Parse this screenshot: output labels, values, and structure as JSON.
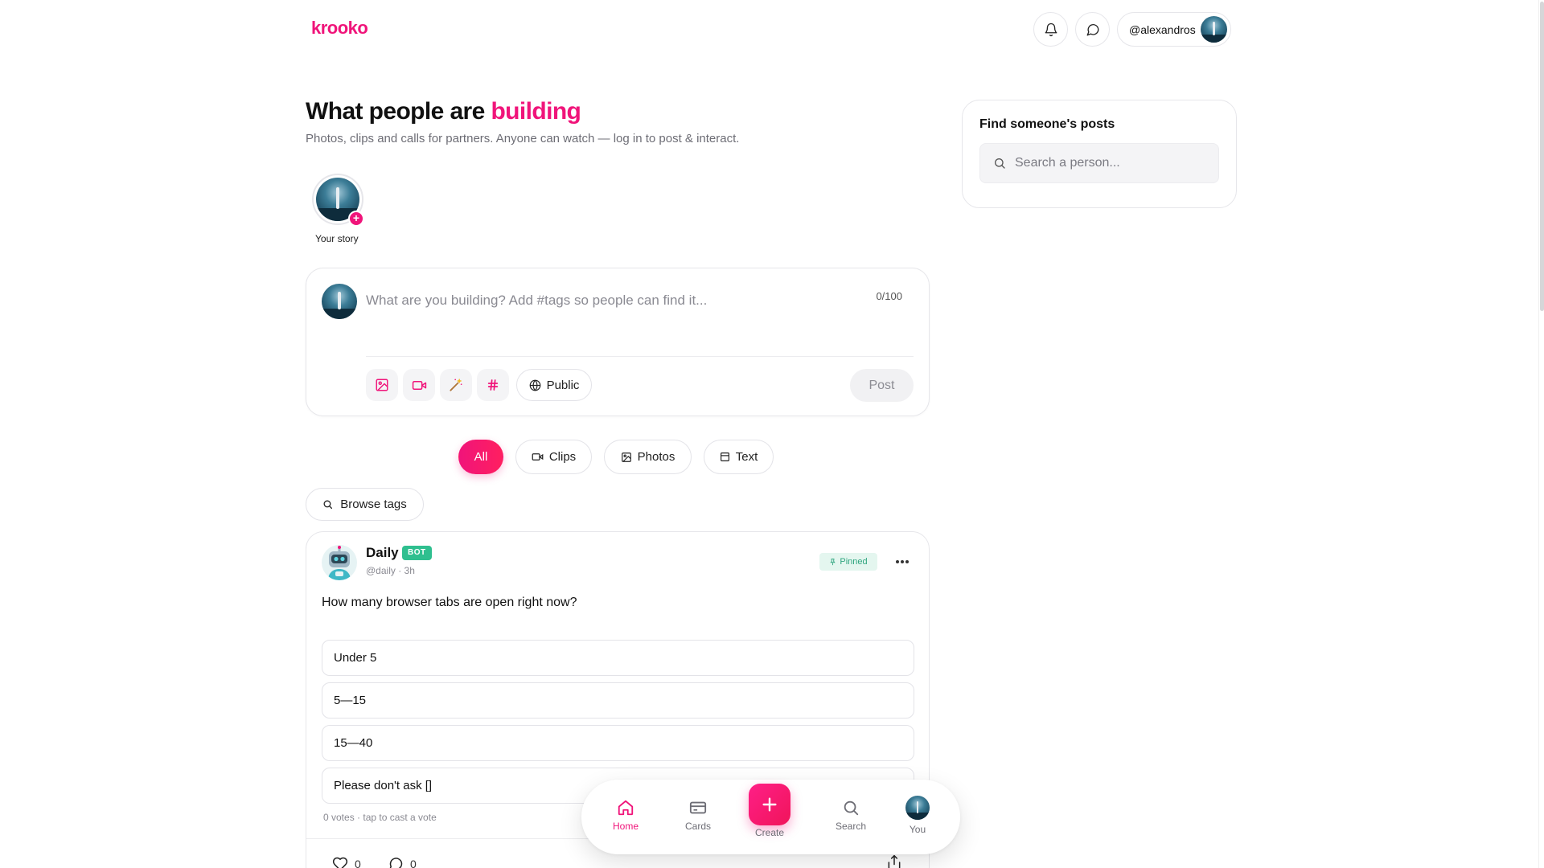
{
  "header": {
    "logo": "krooko",
    "username": "@alexandros"
  },
  "hero": {
    "title_prefix": "What people are ",
    "title_accent": "building",
    "subtitle": "Photos, clips and calls for partners. Anyone can watch — log in to post & interact."
  },
  "stories": {
    "own_label": "Your story"
  },
  "composer": {
    "placeholder": "What are you building? Add #tags so people can find it...",
    "char_count": "0/100",
    "visibility_label": "Public",
    "post_label": "Post"
  },
  "filters": {
    "items": [
      {
        "label": "All",
        "icon": "none",
        "active": true
      },
      {
        "label": "Clips",
        "icon": "video-icon",
        "active": false
      },
      {
        "label": "Photos",
        "icon": "image-icon",
        "active": false
      },
      {
        "label": "Text",
        "icon": "text-icon",
        "active": false
      }
    ],
    "browse_tags_label": "Browse tags"
  },
  "post": {
    "author_name": "Daily",
    "badge": "BOT",
    "meta": "@daily · 3h",
    "pinned_label": "Pinned",
    "question": "How many browser tabs are open right now?",
    "options": [
      "Under 5",
      "5—15",
      "15—40",
      "Please don't ask []"
    ],
    "votes_text": "0 votes · tap to cast a vote",
    "likes": "0",
    "comments": "0"
  },
  "sidebar": {
    "title": "Find someone's posts",
    "search_placeholder": "Search a person..."
  },
  "bottom_nav": {
    "items": [
      {
        "label": "Home",
        "icon": "home-icon",
        "active": true
      },
      {
        "label": "Cards",
        "icon": "cards-icon",
        "active": false
      },
      {
        "label": "Create",
        "icon": "plus-icon",
        "active": false
      },
      {
        "label": "Search",
        "icon": "search-icon",
        "active": false
      },
      {
        "label": "You",
        "icon": "avatar",
        "active": false
      }
    ]
  },
  "colors": {
    "accent": "#f0147a",
    "bot_badge": "#2fbf8f",
    "pinned_bg": "#e4f6ef"
  }
}
